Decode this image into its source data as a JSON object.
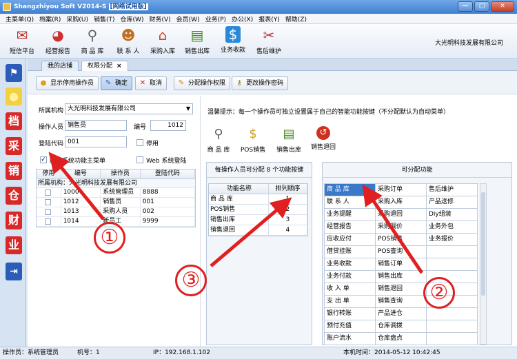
{
  "window": {
    "title": "Shangzhiyou Soft V2014-S",
    "title_highlight": "[网络试用版]",
    "btn_min": "—",
    "btn_max": "□",
    "btn_close": "✕"
  },
  "menu": [
    "主菜单(Q)",
    "档案(R)",
    "采购(U)",
    "销售(T)",
    "仓库(W)",
    "财务(V)",
    "会员(W)",
    "业务(P)",
    "办公(X)",
    "报表(Y)",
    "帮助(Z)"
  ],
  "toolbar": {
    "items": [
      {
        "label": "短信平台",
        "icon": "envelope-icon"
      },
      {
        "label": "经营报告",
        "icon": "pie-chart-icon"
      },
      {
        "label": "商 品 库",
        "icon": "magnifier-icon"
      },
      {
        "label": "联 系 人",
        "icon": "contact-icon"
      },
      {
        "label": "采购入库",
        "icon": "home-icon"
      },
      {
        "label": "销售出库",
        "icon": "sales-out-icon"
      },
      {
        "label": "业务收款",
        "icon": "dollar-icon"
      },
      {
        "label": "售后维护",
        "icon": "tools-icon"
      }
    ],
    "company": "大光明科技发展有限公司"
  },
  "leftnav": [
    "flag-icon",
    "bulb-icon",
    "档",
    "采",
    "销",
    "仓",
    "财",
    "业",
    "exit-icon"
  ],
  "tabs": [
    {
      "label": "我的店铺"
    },
    {
      "label": "权限分配",
      "close": "×"
    }
  ],
  "actions": {
    "show_disabled": "显示停用操作员",
    "confirm": "确定",
    "cancel": "取消",
    "assign": "分配操作权限",
    "change_pwd": "更改操作密码"
  },
  "form": {
    "org_label": "所属机构",
    "org_value": "大光明科技发展有限公司",
    "operator_label": "操作人员",
    "operator_value": "销售员",
    "no_label": "编号",
    "no_value": "1012",
    "login_label": "登陆代码",
    "login_value": "001",
    "disabled_label": "停用",
    "hide_menu_label": "隐藏系统功能主菜单",
    "hide_menu_check": "✓",
    "web_label": "Web 系统登陆"
  },
  "op_table": {
    "headers": [
      "停用",
      "编号",
      "操作员",
      "登陆代码"
    ],
    "group": "所属机构：大光明科技发展有限公司",
    "rows": [
      {
        "no": "1000",
        "name": "系统管理员",
        "code": "8888"
      },
      {
        "no": "1012",
        "name": "销售员",
        "code": "001"
      },
      {
        "no": "1013",
        "name": "采购人员",
        "code": "002"
      },
      {
        "no": "1014",
        "name": "新员工",
        "code": "9999"
      }
    ]
  },
  "right": {
    "tip": "温馨提示：每一个操作员可独立设置属于自己的智能功能按键（不分配默认为自动菜单）",
    "quick": [
      {
        "label": "商 品 库",
        "icon": "magnifier-icon"
      },
      {
        "label": "POS销售",
        "icon": "pos-coin-icon"
      },
      {
        "label": "销售出库",
        "icon": "sales-out-icon"
      },
      {
        "label": "销售退回",
        "icon": "return-icon"
      }
    ],
    "mid_title": "每操作人员可分配 8 个功能按键",
    "mid_headers": [
      "功能名称",
      "排列顺序"
    ],
    "mid_rows": [
      {
        "name": "商 品 库",
        "order": "1"
      },
      {
        "name": "POS销售",
        "order": "2"
      },
      {
        "name": "销售出库",
        "order": "3"
      },
      {
        "name": "销售退回",
        "order": "4"
      }
    ],
    "avail_title": "可分配功能",
    "avail_rows": [
      [
        "商 品 库",
        "采购订单",
        "售后维护"
      ],
      [
        "联 系 人",
        "采购入库",
        "产品送修"
      ],
      [
        "业务提醒",
        "采购退回",
        "Diy组装"
      ],
      [
        "经营报告",
        "采购调价",
        "业务外包"
      ],
      [
        "应收应付",
        "POS销售",
        "业务报价"
      ],
      [
        "借贷挂账",
        "POS查询",
        ""
      ],
      [
        "业务收款",
        "销售订单",
        ""
      ],
      [
        "业务付款",
        "销售出库",
        ""
      ],
      [
        "收 入 单",
        "销售退回",
        ""
      ],
      [
        "支 出 单",
        "销售查询",
        ""
      ],
      [
        "银行转账",
        "产品进仓",
        ""
      ],
      [
        "预付充值",
        "仓库调拨",
        ""
      ],
      [
        "账户流水",
        "仓库盘点",
        ""
      ]
    ]
  },
  "status": {
    "operator": "操作员：系统管理员",
    "machine": "机号：1",
    "ip": "IP：192.168.1.102",
    "time": "本机时间：2014-05-12 10:42:45"
  },
  "annotations": [
    "①",
    "②",
    "③"
  ],
  "colors": {
    "title_bar": "#3f7fd0",
    "selected": "#3a78c8",
    "annotation": "#e02020"
  }
}
